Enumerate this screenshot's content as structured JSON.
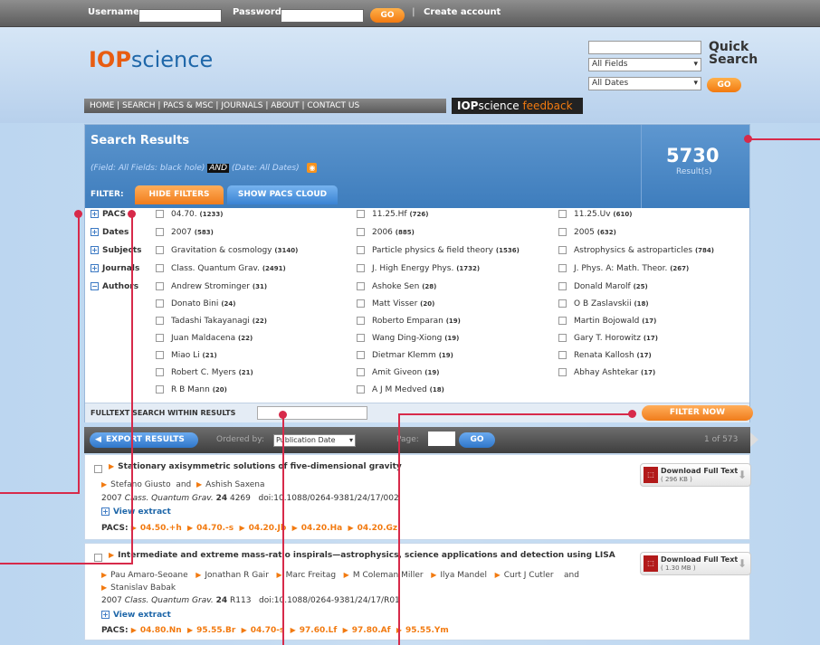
{
  "topbar": {
    "username_label": "Username",
    "password_label": "Password",
    "go": "GO",
    "sep": "|",
    "create_account": "Create account"
  },
  "header": {
    "logo_iop": "IOP",
    "logo_science": "science",
    "quick_search_title_1": "Quick",
    "quick_search_title_2": "Search",
    "field_select": "All Fields",
    "date_select": "All Dates",
    "go": "GO"
  },
  "nav": {
    "text": "HOME  |  SEARCH  |  PACS & MSC  |  JOURNALS  |  ABOUT  |  CONTACT US"
  },
  "feedback": {
    "iop": "IOP",
    "science": "science",
    "feedback": "feedback"
  },
  "search": {
    "title": "Search Results",
    "query_a": "(Field: All Fields: black hole)",
    "query_and": "AND",
    "query_b": "(Date: All Dates)",
    "count": "5730",
    "results_label": "Result(s)",
    "filter_label": "FILTER:",
    "hide_filters": "HIDE FILTERS",
    "show_pacs": "SHOW PACS CLOUD"
  },
  "filters": {
    "pacs": {
      "label": "PACS",
      "sign": "+",
      "items": [
        {
          "t": "04.70.",
          "c": "(1233)"
        },
        {
          "t": "11.25.Hf",
          "c": "(726)"
        },
        {
          "t": "11.25.Uv",
          "c": "(610)"
        }
      ]
    },
    "dates": {
      "label": "Dates",
      "sign": "+",
      "items": [
        {
          "t": "2007",
          "c": "(583)"
        },
        {
          "t": "2006",
          "c": "(885)"
        },
        {
          "t": "2005",
          "c": "(632)"
        }
      ]
    },
    "subjects": {
      "label": "Subjects",
      "sign": "+",
      "items": [
        {
          "t": "Gravitation & cosmology",
          "c": "(3140)"
        },
        {
          "t": "Particle physics & field theory",
          "c": "(1536)"
        },
        {
          "t": "Astrophysics & astroparticles",
          "c": "(784)"
        }
      ]
    },
    "journals": {
      "label": "Journals",
      "sign": "+",
      "items": [
        {
          "t": "Class. Quantum Grav.",
          "c": "(2491)"
        },
        {
          "t": "J. High Energy Phys.",
          "c": "(1732)"
        },
        {
          "t": "J. Phys. A: Math. Theor.",
          "c": "(267)"
        }
      ]
    },
    "authors": {
      "label": "Authors",
      "sign": "−",
      "items": [
        {
          "t": "Andrew Strominger",
          "c": "(31)"
        },
        {
          "t": "Ashoke Sen",
          "c": "(28)"
        },
        {
          "t": "Donald Marolf",
          "c": "(25)"
        },
        {
          "t": "Donato Bini",
          "c": "(24)"
        },
        {
          "t": "Matt Visser",
          "c": "(20)"
        },
        {
          "t": "O B Zaslavskii",
          "c": "(18)"
        },
        {
          "t": "Tadashi Takayanagi",
          "c": "(22)"
        },
        {
          "t": "Roberto Emparan",
          "c": "(19)"
        },
        {
          "t": "Martin Bojowald",
          "c": "(17)"
        },
        {
          "t": "Juan Maldacena",
          "c": "(22)"
        },
        {
          "t": "Wang Ding-Xiong",
          "c": "(19)"
        },
        {
          "t": "Gary T. Horowitz",
          "c": "(17)"
        },
        {
          "t": "Miao Li",
          "c": "(21)"
        },
        {
          "t": "Dietmar Klemm",
          "c": "(19)"
        },
        {
          "t": "Renata Kallosh",
          "c": "(17)"
        },
        {
          "t": "Robert C. Myers",
          "c": "(21)"
        },
        {
          "t": "Amit Giveon",
          "c": "(19)"
        },
        {
          "t": "Abhay Ashtekar",
          "c": "(17)"
        },
        {
          "t": "R B Mann",
          "c": "(20)"
        },
        {
          "t": "A J M Medved",
          "c": "(18)"
        }
      ]
    }
  },
  "fulltext": {
    "label": "FULLTEXT SEARCH WITHIN RESULTS",
    "filter_now": "FILTER NOW"
  },
  "results_bar": {
    "export": "EXPORT RESULTS",
    "ordered_by": "Ordered by:",
    "order_value": "Publication Date",
    "page": "Page:",
    "go": "GO",
    "page_of": "1 of 573"
  },
  "results": [
    {
      "title": "Stationary axisymmetric solutions of five-dimensional gravity",
      "authors": [
        "Stefano Giusto",
        "and",
        "Ashish Saxena"
      ],
      "year": "2007",
      "journal": "Class. Quantum Grav.",
      "volume": "24",
      "page": "4269",
      "doi": "doi:10.1088/0264-9381/24/17/002",
      "view_extract": "View extract",
      "pacs_label": "PACS:",
      "pacs": [
        "04.50.+h",
        "04.70.-s",
        "04.20.Jb",
        "04.20.Ha",
        "04.20.Gz"
      ],
      "download": "Download Full Text",
      "size": "( 296 KB )"
    },
    {
      "title": "Intermediate and extreme mass-ratio inspirals—astrophysics, science applications and detection using LISA",
      "authors_line1": [
        "Pau Amaro-Seoane",
        "Jonathan R Gair",
        "Marc Freitag",
        "M Coleman Miller",
        "Ilya Mandel",
        "Curt J Cutler",
        "and"
      ],
      "authors_line2": [
        "Stanislav Babak"
      ],
      "year": "2007",
      "journal": "Class. Quantum Grav.",
      "volume": "24",
      "page": "R113",
      "doi": "doi:10.1088/0264-9381/24/17/R01",
      "view_extract": "View extract",
      "pacs_label": "PACS:",
      "pacs": [
        "04.80.Nn",
        "95.55.Br",
        "04.70-s",
        "97.60.Lf",
        "97.80.Af",
        "95.55.Ym"
      ],
      "download": "Download Full Text",
      "size": "( 1.30 MB )"
    }
  ]
}
